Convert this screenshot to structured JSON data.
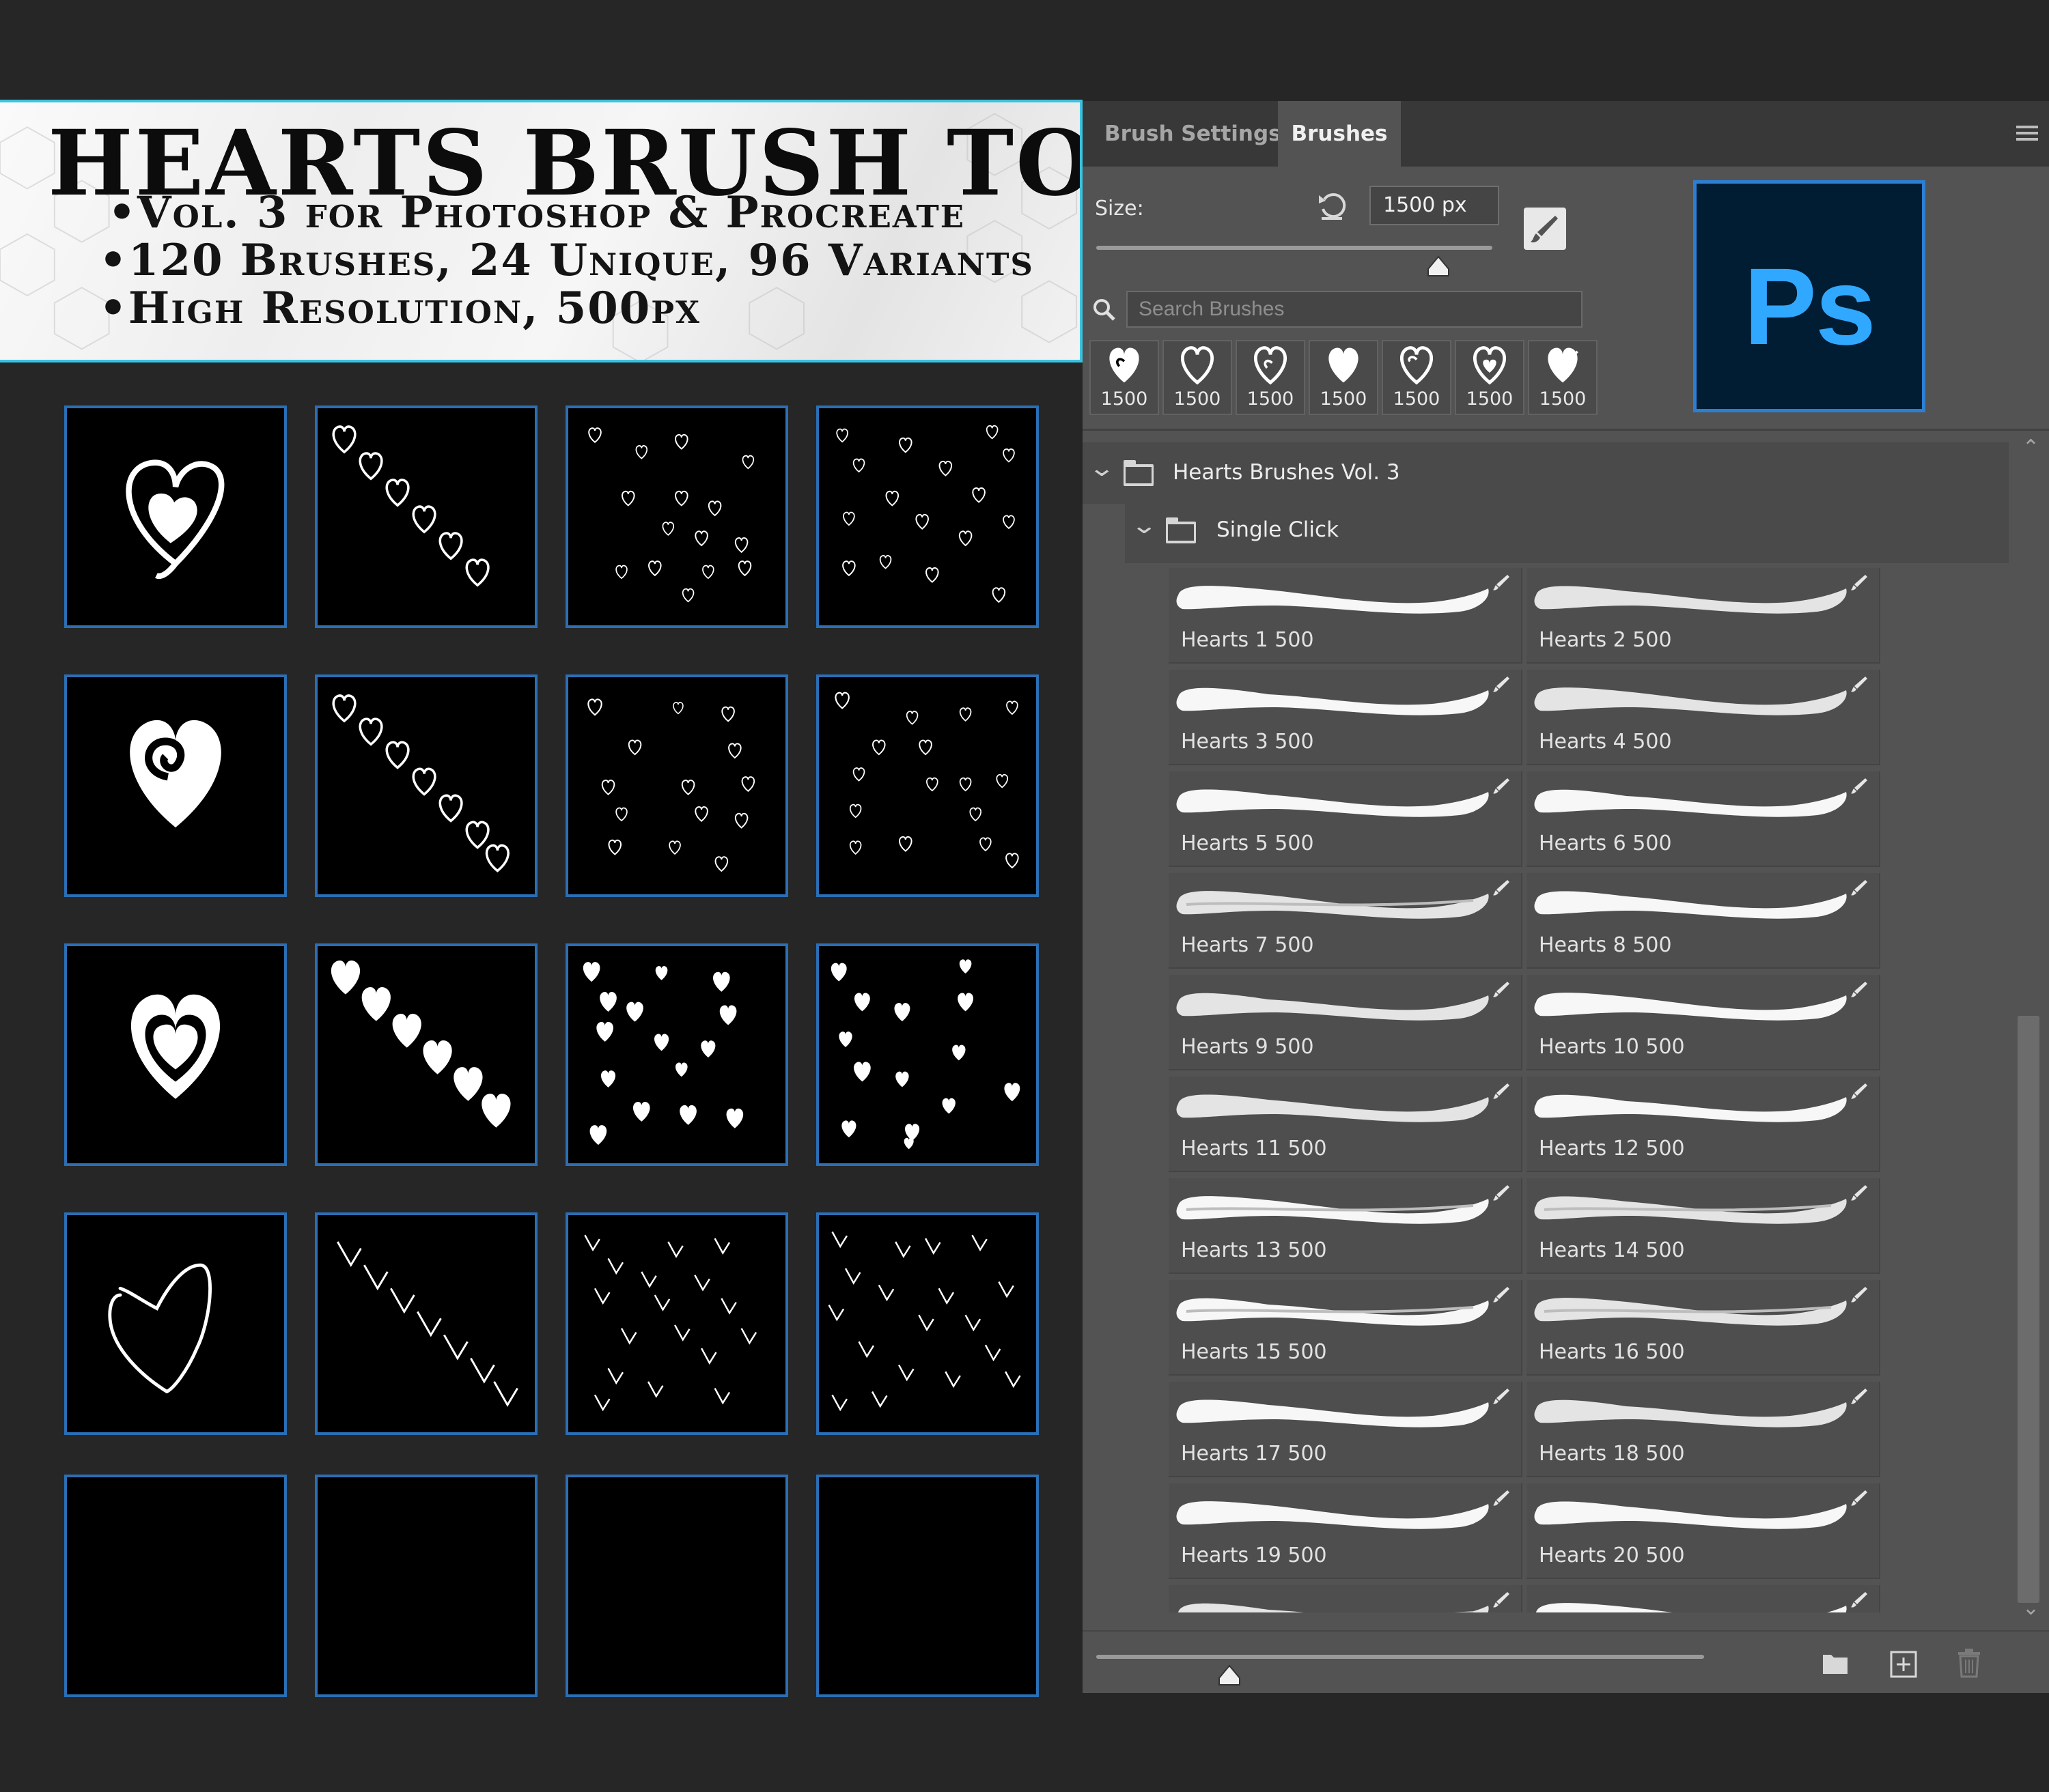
{
  "banner": {
    "title": "HEARTS BRUSH TOOLS",
    "bullets": [
      "•Vol. 3 for Photoshop & Procreate",
      "•120 Brushes, 24 Unique, 96 Variants",
      "•High Resolution, 500px"
    ]
  },
  "preview_grid": {
    "rows": [
      {
        "style": "outline-swirl-heart",
        "tiles": [
          "single",
          "diagonal",
          "scatter",
          "scatter-dense"
        ]
      },
      {
        "style": "spiral-heart",
        "tiles": [
          "single",
          "diagonal",
          "scatter",
          "scatter-dense"
        ]
      },
      {
        "style": "double-heart",
        "tiles": [
          "single",
          "diagonal",
          "scatter",
          "scatter-dense"
        ]
      },
      {
        "style": "sketch-heart",
        "tiles": [
          "single",
          "diagonal",
          "scatter",
          "scatter-dense"
        ]
      },
      {
        "style": "empty",
        "tiles": [
          "empty",
          "empty",
          "empty",
          "empty"
        ]
      }
    ],
    "border_color": "#2a6fb5"
  },
  "panel": {
    "tabs": [
      "Brush Settings",
      "Brushes"
    ],
    "active_tab": "Brushes",
    "size_label": "Size:",
    "size_value": "1500 px",
    "search_placeholder": "Search Brushes",
    "logo_text": "Ps",
    "recent_brushes": [
      "1500",
      "1500",
      "1500",
      "1500",
      "1500",
      "1500",
      "1500"
    ],
    "group_name": "Hearts Brushes Vol. 3",
    "subgroup_name": "Single Click",
    "brushes": [
      "Hearts 1 500",
      "Hearts 2 500",
      "Hearts 3 500",
      "Hearts 4 500",
      "Hearts 5 500",
      "Hearts 6 500",
      "Hearts 7 500",
      "Hearts 8 500",
      "Hearts 9 500",
      "Hearts 10 500",
      "Hearts 11 500",
      "Hearts 12 500",
      "Hearts 13 500",
      "Hearts 14 500",
      "Hearts 15 500",
      "Hearts 16 500",
      "Hearts 17 500",
      "Hearts 18 500",
      "Hearts 19 500",
      "Hearts 20 500",
      "",
      ""
    ],
    "icons": {
      "menu": "hamburger-icon",
      "reset": "reset-icon",
      "tool": "brush-tool-icon",
      "search": "search-icon",
      "new_group": "folder-icon",
      "new_brush": "add-icon",
      "delete": "trash-icon"
    }
  }
}
